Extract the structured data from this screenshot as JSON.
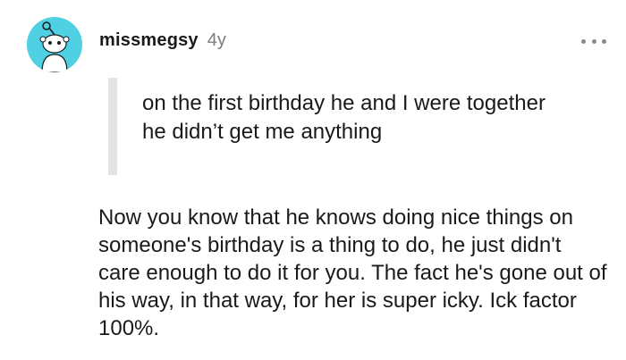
{
  "comment": {
    "author": "missmegsy",
    "age": "4y",
    "avatar_icon": "reddit-snoo-icon",
    "avatar_color": "#4fd1e3",
    "more_icon": "more-options-icon",
    "quote": "on the first birthday he and I were together he didn’t get me anything",
    "body": "Now you know that he knows doing nice things on someone's birthday is a thing to do, he just didn't care enough to do it for you. The fact he's gone out of his way, in that way, for her is super icky. Ick factor 100%."
  }
}
